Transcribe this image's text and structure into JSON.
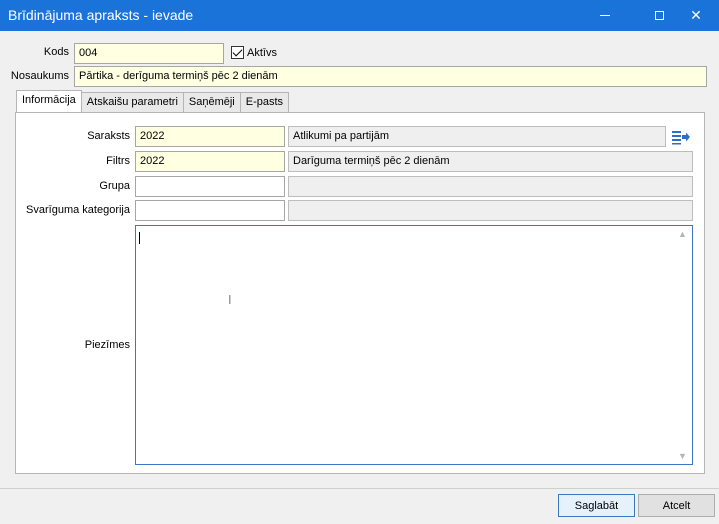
{
  "window": {
    "title": "Brīdinājuma apraksts - ievade",
    "controls": {
      "minimize": "minimize",
      "maximize": "maximize",
      "close": "✕"
    }
  },
  "header": {
    "kods_label": "Kods",
    "kods_value": "004",
    "aktivs_label": "Aktīvs",
    "aktivs_checked": true,
    "nosaukums_label": "Nosaukums",
    "nosaukums_value": "Pārtika - derīguma termiņš pēc 2 dienām"
  },
  "tabs": [
    {
      "label": "Informācija",
      "active": true
    },
    {
      "label": "Atskaišu parametri",
      "active": false
    },
    {
      "label": "Saņēmēji",
      "active": false
    },
    {
      "label": "E-pasts",
      "active": false
    }
  ],
  "form": {
    "saraksts": {
      "label": "Saraksts",
      "code": "2022",
      "name": "Atlikumi pa partijām"
    },
    "filtrs": {
      "label": "Filtrs",
      "code": "2022",
      "name": "Darīguma termiņš pēc 2 dienām"
    },
    "grupa": {
      "label": "Grupa",
      "code": "",
      "name": ""
    },
    "svarigums": {
      "label": "Svarīguma kategorija",
      "code": "",
      "name": ""
    },
    "piezimes": {
      "label": "Piezīmes",
      "value": ""
    }
  },
  "footer": {
    "save_label": "Saglabāt",
    "cancel_label": "Atcelt"
  },
  "colors": {
    "titlebar": "#1a73d9",
    "field_yellow": "#ffffe1",
    "field_gray": "#efefef",
    "accent": "#3b78c4"
  }
}
